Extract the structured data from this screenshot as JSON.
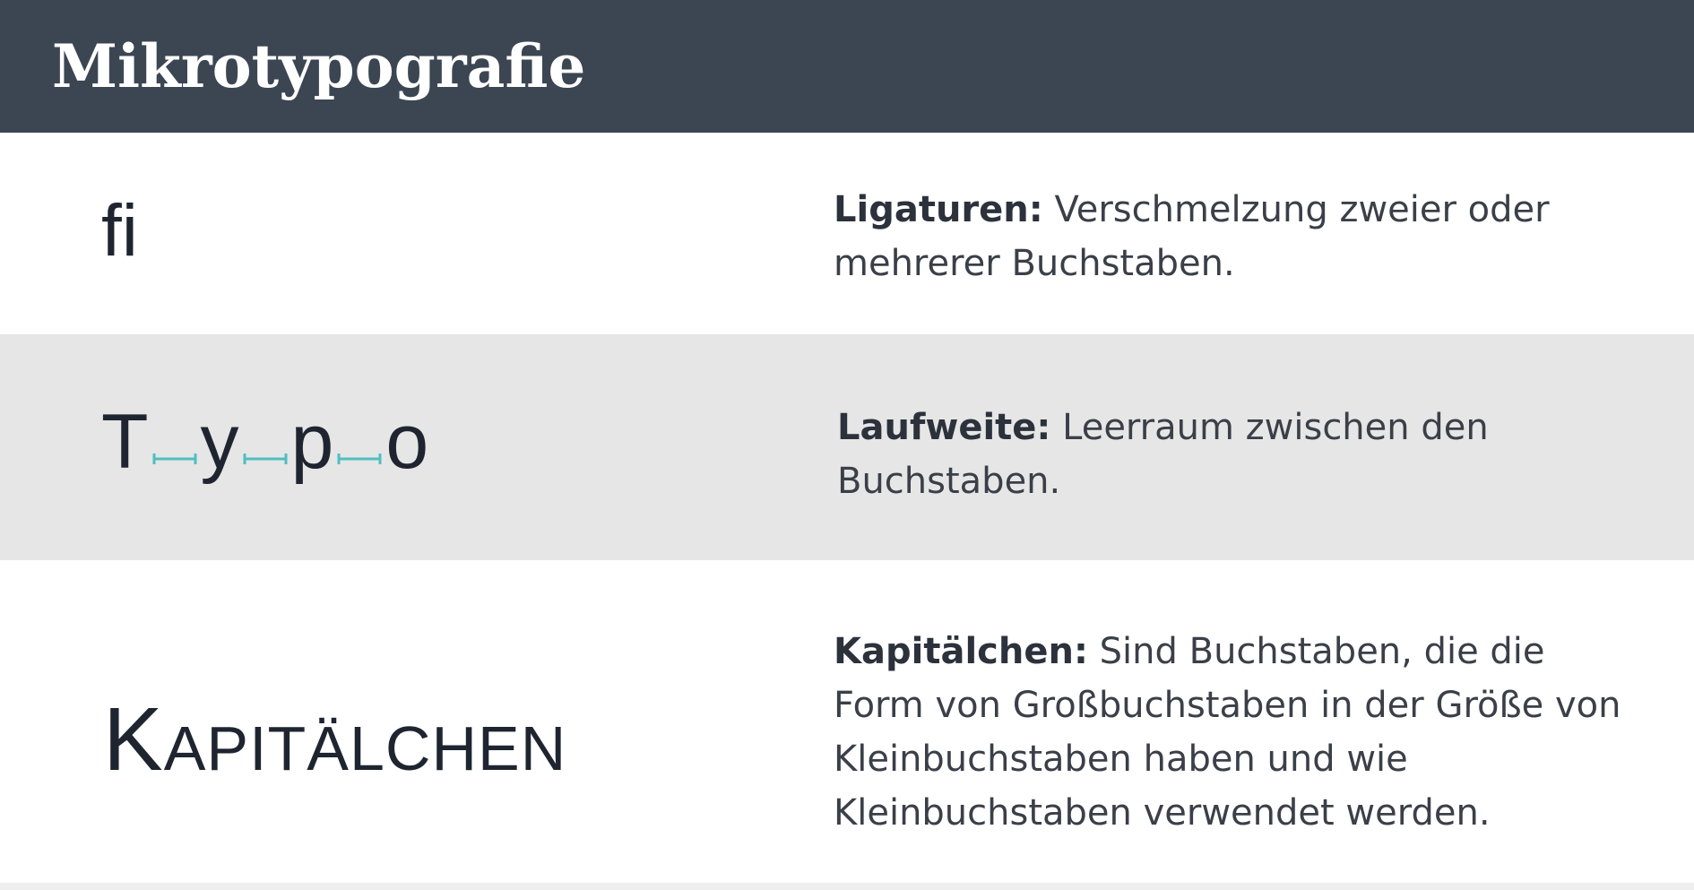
{
  "header": {
    "title": "Mikrotypografie"
  },
  "colors": {
    "header_bg": "#3c4653",
    "row_alt_bg": "#e6e6e6",
    "accent_tracking": "#4fbfc0"
  },
  "rows": [
    {
      "sample": "fi",
      "term": "Ligaturen:",
      "description": " Verschmelzung zweier oder mehrerer Buchstaben."
    },
    {
      "sample_letters": [
        "T",
        "y",
        "p",
        "o"
      ],
      "term": "Laufweite:",
      "description": " Leerraum zwischen den Buchstaben."
    },
    {
      "sample": "Kapitälchen",
      "term": "Kapitälchen:",
      "description": " Sind Buchstaben, die die Form von Großbuchstaben in der Größe von Kleinbuchstaben haben und wie Kleinbuchstaben verwendet werden."
    }
  ]
}
